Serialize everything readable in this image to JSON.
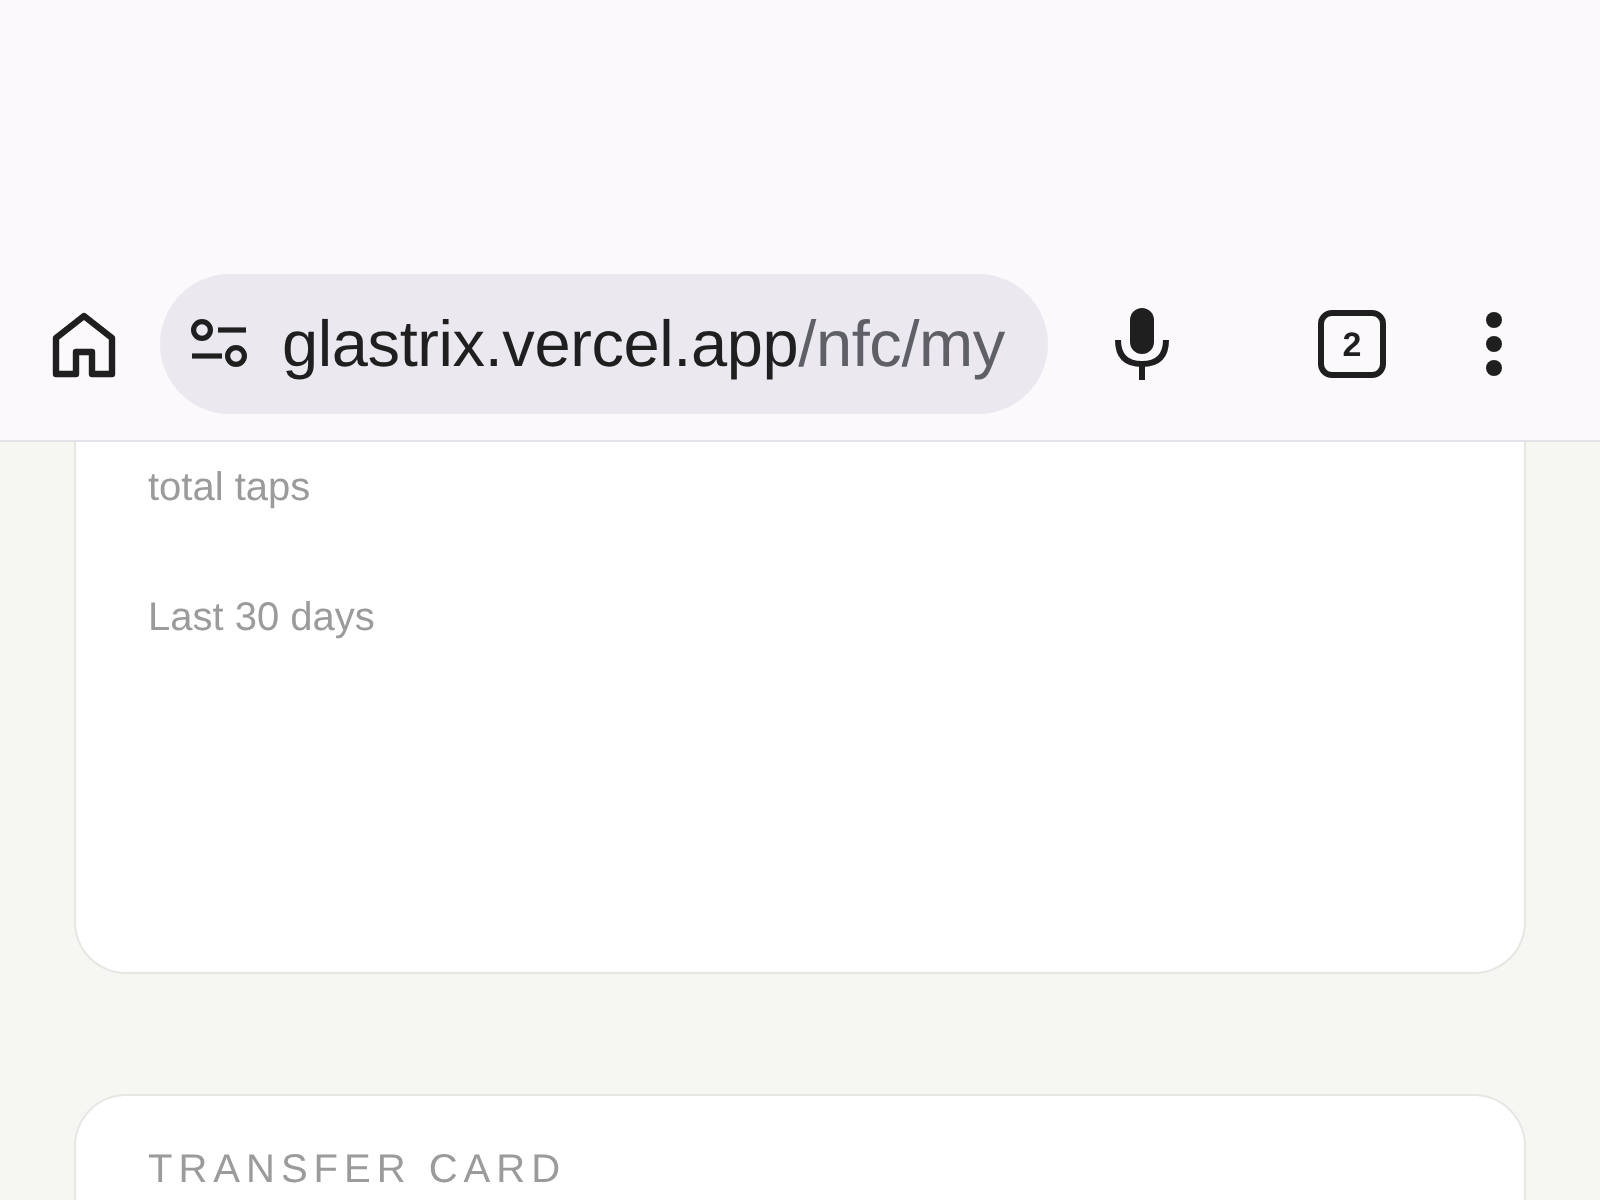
{
  "browser": {
    "url": {
      "host": "glastrix.vercel.app",
      "path": "/nfc/my"
    },
    "tab_count": "2"
  },
  "stats_card": {
    "label": "total taps",
    "period": "Last 30 days"
  },
  "transfer_card": {
    "title": "TRANSFER CARD"
  }
}
